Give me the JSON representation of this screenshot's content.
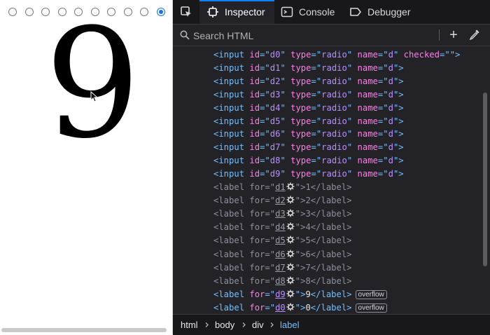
{
  "preview": {
    "radios": [
      {
        "id": "d0",
        "checked": false
      },
      {
        "id": "d1",
        "checked": false
      },
      {
        "id": "d2",
        "checked": false
      },
      {
        "id": "d3",
        "checked": false
      },
      {
        "id": "d4",
        "checked": false
      },
      {
        "id": "d5",
        "checked": false
      },
      {
        "id": "d6",
        "checked": false
      },
      {
        "id": "d7",
        "checked": false
      },
      {
        "id": "d8",
        "checked": false
      },
      {
        "id": "d9",
        "checked": true
      }
    ],
    "digit": "9"
  },
  "devtools": {
    "tabs": {
      "inspector": "Inspector",
      "console": "Console",
      "debugger": "Debugger"
    },
    "search": {
      "placeholder": "Search HTML",
      "add_symbol": "+"
    },
    "tree": {
      "lt": "<",
      "gt": ">",
      "close_lt": "</",
      "eq": "=",
      "q": "\"",
      "input_tag": "input",
      "label_tag": "label",
      "attr_id": "id",
      "attr_type": "type",
      "attr_name": "name",
      "attr_checked": "checked",
      "attr_for": "for",
      "type_value": "radio",
      "name_value": "d",
      "checked_value": "",
      "inputs": [
        "d0",
        "d1",
        "d2",
        "d3",
        "d4",
        "d5",
        "d6",
        "d7",
        "d8",
        "d9"
      ],
      "labels": [
        {
          "for": "d1",
          "text": "1",
          "badge": ""
        },
        {
          "for": "d2",
          "text": "2",
          "badge": ""
        },
        {
          "for": "d3",
          "text": "3",
          "badge": ""
        },
        {
          "for": "d4",
          "text": "4",
          "badge": ""
        },
        {
          "for": "d5",
          "text": "5",
          "badge": ""
        },
        {
          "for": "d6",
          "text": "6",
          "badge": ""
        },
        {
          "for": "d7",
          "text": "7",
          "badge": ""
        },
        {
          "for": "d8",
          "text": "8",
          "badge": ""
        },
        {
          "for": "d9",
          "text": "9",
          "badge": "overflow"
        },
        {
          "for": "d0",
          "text": "0",
          "badge": "overflow"
        }
      ]
    },
    "breadcrumbs": [
      "html",
      "body",
      "div",
      "label"
    ]
  },
  "colors": {
    "tag": "#75bfff",
    "attribute": "#ff7de9",
    "value": "#b98eff",
    "accent": "#0a84ff",
    "radio_checked": "#1a73e8"
  }
}
